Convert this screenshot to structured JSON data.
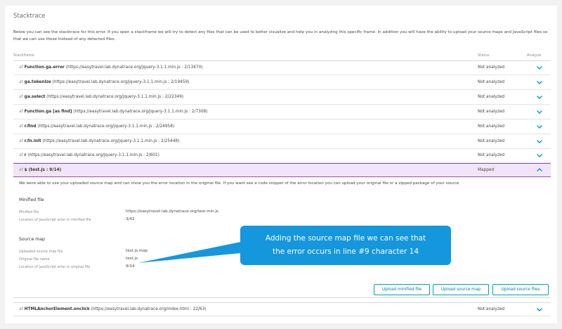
{
  "title": "Stacktrace",
  "intro": "Below you can see the stacktrace for this error. If you open a stackframe we will try to detect any files that can be used to better visualize and help you in analyzing this specific frame. In addition you will have the ability to upload your source maps and JavaScript files so that we can use these instead of any detected files.",
  "columns": {
    "stackframe": "Stackframe",
    "status": "Status",
    "analyze": "Analyze"
  },
  "frames": [
    {
      "prefix": "at",
      "fn": "Function.ga.error",
      "loc": "(https://easytravel.lab.dynatrace.org/jquery-3.1.1.min.js : 2/13470)",
      "status": "Not analyzed"
    },
    {
      "prefix": "at",
      "fn": "ga.tokenize",
      "loc": "(https://easytravel.lab.dynatrace.org/jquery-3.1.1.min.js : 2/19459)",
      "status": "Not analyzed"
    },
    {
      "prefix": "at",
      "fn": "ga.select",
      "loc": "(https://easytravel.lab.dynatrace.org/jquery-3.1.1.min.js : 2/22349)",
      "status": "Not analyzed"
    },
    {
      "prefix": "at",
      "fn": "Function.ga [as find]",
      "loc": "(https://easytravel.lab.dynatrace.org/jquery-3.1.1.min.js : 2/7308)",
      "status": "Not analyzed"
    },
    {
      "prefix": "at",
      "fn": "r.find",
      "loc": "(https://easytravel.lab.dynatrace.org/jquery-3.1.1.min.js : 2/24958)",
      "status": "Not analyzed"
    },
    {
      "prefix": "at",
      "fn": "r.fn.init",
      "loc": "(https://easytravel.lab.dynatrace.org/jquery-3.1.1.min.js : 2/25448)",
      "status": "Not analyzed"
    },
    {
      "prefix": "at",
      "fn": "r",
      "loc": "(https://easytravel.lab.dynatrace.org/jquery-3.1.1.min.js : 2/601)",
      "status": "Not analyzed"
    }
  ],
  "mapped_frame": {
    "prefix": "at",
    "fn": "$ (test.js : 9/14)",
    "status": "Mapped"
  },
  "details": {
    "message": "We were able to use your uploaded source map and can show you the error location in the original file. If you want see a code snippet of the error location you can upload your original file or a zipped package of your source.",
    "minified_heading": "Minified file",
    "minified": [
      {
        "label": "Minified file",
        "value": "https://easytravel.lab.dynatrace.org/test.min.js"
      },
      {
        "label": "Location of JavaScript error in minified file",
        "value": "3/42"
      }
    ],
    "sourcemap_heading": "Source map",
    "sourcemap": [
      {
        "label": "Uploaded source map file",
        "value": "test.js.map"
      },
      {
        "label": "Original file name",
        "value": "test.js"
      },
      {
        "label": "Location of JavaScript error in original file",
        "value": "9/14"
      }
    ],
    "buttons": {
      "upload_minified": "Upload minified file",
      "upload_sourcemap": "Upload source map",
      "upload_sources": "Upload source files"
    }
  },
  "last_frame": {
    "prefix": "at",
    "fn": "HTMLAnchorElement.onclick",
    "loc": "(https://easytravel.lab.dynatrace.org/index.html : 22/63)",
    "status": "Not analyzed"
  },
  "callout": {
    "line1": "Adding the source map file we can see that",
    "line2": "the error occurs in line #9 character 14"
  },
  "colors": {
    "accent": "#00a1b2",
    "chevron": "#00a1b2",
    "mapped_bg": "#f2e4f7",
    "mapped_border": "#9a4bb3",
    "callout_bg": "#1497dd"
  }
}
